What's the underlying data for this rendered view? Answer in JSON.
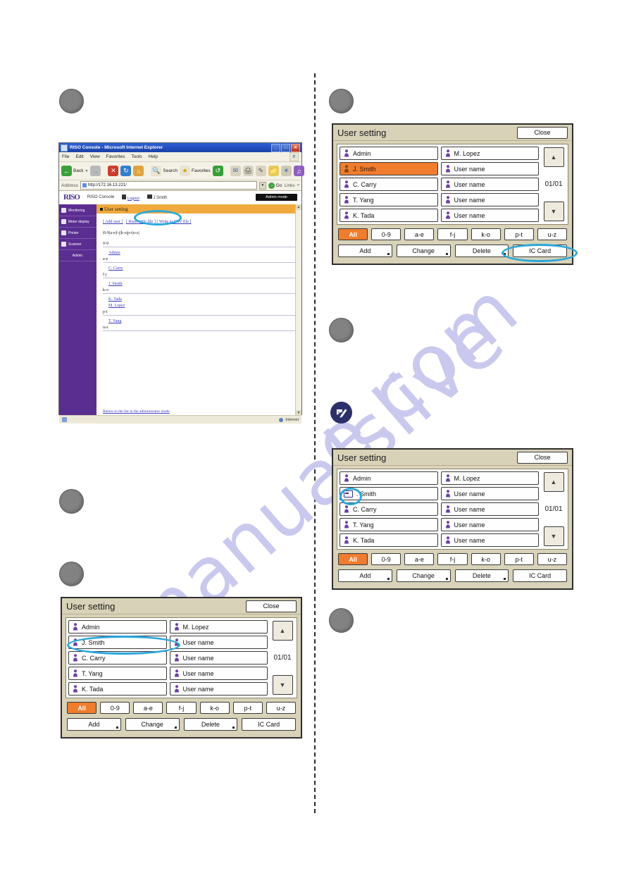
{
  "watermark": {
    "line1": "manualslive",
    "line2": "e.com"
  },
  "browser": {
    "title": "RISO Console - Microsoft Internet Explorer",
    "window_buttons": [
      "_",
      "□",
      "✕"
    ],
    "menu": [
      "File",
      "Edit",
      "View",
      "Favorites",
      "Tools",
      "Help"
    ],
    "toolbar": [
      {
        "label": "Back",
        "icon": "back-arrow-icon"
      },
      {
        "label": "",
        "icon": "forward-arrow-icon"
      },
      {
        "label": "",
        "icon": "stop-icon"
      },
      {
        "label": "",
        "icon": "refresh-icon"
      },
      {
        "label": "",
        "icon": "home-icon"
      },
      {
        "label": "Search",
        "icon": "search-icon"
      },
      {
        "label": "Favorites",
        "icon": "star-icon"
      },
      {
        "label": "",
        "icon": "history-icon"
      },
      {
        "label": "",
        "icon": "mail-icon"
      },
      {
        "label": "",
        "icon": "print-icon"
      },
      {
        "label": "",
        "icon": "edit-icon"
      },
      {
        "label": "",
        "icon": "folder-icon"
      },
      {
        "label": "",
        "icon": "messenger-icon"
      },
      {
        "label": "",
        "icon": "media-icon"
      }
    ],
    "address_label": "Address",
    "address_value": "http://172.16.13.221/",
    "go_label": "Go",
    "links_label": "Links",
    "status_text": "Internet"
  },
  "riso": {
    "logo": "RISO",
    "console_label": "RISO Console",
    "logout_label": "Logout",
    "user_label": "J.Smith",
    "admin_mode_label": "Admin mode",
    "sidebar": [
      {
        "label": "Monitoring",
        "icon": "monitor-icon"
      },
      {
        "label": "Meter display",
        "icon": "meter-icon"
      },
      {
        "label": "Printer",
        "icon": "printer-icon"
      },
      {
        "label": "Scanner",
        "icon": "scanner-icon"
      },
      {
        "label": "Admin.",
        "icon": ""
      }
    ],
    "page_title": "User setting",
    "links": {
      "add_user": "[ Add user ]",
      "read_csv": "[ Read CSV file ]",
      "write_csv": "[ Write to CSV file ]"
    },
    "index_line": "|0-9|a-e|f-j|k-o|p-t|u-z|",
    "groups": [
      {
        "head": "0-9",
        "names": [
          "Admin"
        ]
      },
      {
        "head": "a-e",
        "names": [
          "C. Carry"
        ]
      },
      {
        "head": "f-j",
        "names": [
          "J. Smith"
        ]
      },
      {
        "head": "k-o",
        "names": [
          "K. Tada",
          "M. Lopez"
        ]
      },
      {
        "head": "p-t",
        "names": [
          "T. Yang"
        ]
      },
      {
        "head": "u-z",
        "names": []
      }
    ],
    "return_link": "Return to the list in the administrator mode"
  },
  "panel_common": {
    "title": "User setting",
    "close_label": "Close",
    "page_indicator": "01/01",
    "scroll_up": "▲",
    "scroll_down": "▼",
    "filters": [
      "All",
      "0-9",
      "a-e",
      "f-j",
      "k-o",
      "p-t",
      "u-z"
    ],
    "active_filter": "All",
    "actions": [
      "Add",
      "Change",
      "Delete",
      "IC Card"
    ]
  },
  "panel_top_right": {
    "left_column": [
      {
        "name": "Admin",
        "icon": "person-icon",
        "selected": false
      },
      {
        "name": "J. Smith",
        "icon": "person-icon",
        "selected": true
      },
      {
        "name": "C. Carry",
        "icon": "person-icon",
        "selected": false
      },
      {
        "name": "T. Yang",
        "icon": "person-icon",
        "selected": false
      },
      {
        "name": "K. Tada",
        "icon": "person-icon",
        "selected": false
      }
    ],
    "right_column": [
      {
        "name": "M. Lopez",
        "icon": "person-icon",
        "selected": false
      },
      {
        "name": "User name",
        "icon": "person-icon",
        "selected": false
      },
      {
        "name": "User name",
        "icon": "person-icon",
        "selected": false
      },
      {
        "name": "User name",
        "icon": "person-icon",
        "selected": false
      },
      {
        "name": "User name",
        "icon": "person-icon",
        "selected": false
      }
    ],
    "highlight": "ic-card-button"
  },
  "panel_mid_right": {
    "left_column": [
      {
        "name": "Admin",
        "icon": "person-icon",
        "selected": false
      },
      {
        "name": ". Smith",
        "icon": "card-icon",
        "selected": false
      },
      {
        "name": "C. Carry",
        "icon": "person-icon",
        "selected": false
      },
      {
        "name": "T. Yang",
        "icon": "person-icon",
        "selected": false
      },
      {
        "name": "K. Tada",
        "icon": "person-icon",
        "selected": false
      }
    ],
    "right_column": [
      {
        "name": "M. Lopez",
        "icon": "person-icon",
        "selected": false
      },
      {
        "name": "User name",
        "icon": "person-icon",
        "selected": false
      },
      {
        "name": "User name",
        "icon": "person-icon",
        "selected": false
      },
      {
        "name": "User name",
        "icon": "person-icon",
        "selected": false
      },
      {
        "name": "User name",
        "icon": "person-icon",
        "selected": false
      }
    ],
    "highlight": "card-icon"
  },
  "panel_bottom_left": {
    "left_column": [
      {
        "name": "Admin",
        "icon": "person-icon",
        "selected": false
      },
      {
        "name": "J. Smith",
        "icon": "person-icon",
        "selected": false
      },
      {
        "name": "C. Carry",
        "icon": "person-icon",
        "selected": false
      },
      {
        "name": "T. Yang",
        "icon": "person-icon",
        "selected": false
      },
      {
        "name": "K. Tada",
        "icon": "person-icon",
        "selected": false
      }
    ],
    "right_column": [
      {
        "name": "M. Lopez",
        "icon": "person-icon",
        "selected": false
      },
      {
        "name": "User name",
        "icon": "person-icon",
        "selected": false
      },
      {
        "name": "User name",
        "icon": "person-icon",
        "selected": false
      },
      {
        "name": "User name",
        "icon": "person-icon",
        "selected": false
      },
      {
        "name": "User name",
        "icon": "person-icon",
        "selected": false
      }
    ],
    "highlight": "j-smith-row"
  },
  "colors": {
    "accent_orange": "#f07c2e",
    "panel_bg": "#d8d2b8",
    "highlight_cyan": "#2aa8dd",
    "riso_purple": "#5a2d91",
    "riso_bar": "#f0a93c"
  }
}
